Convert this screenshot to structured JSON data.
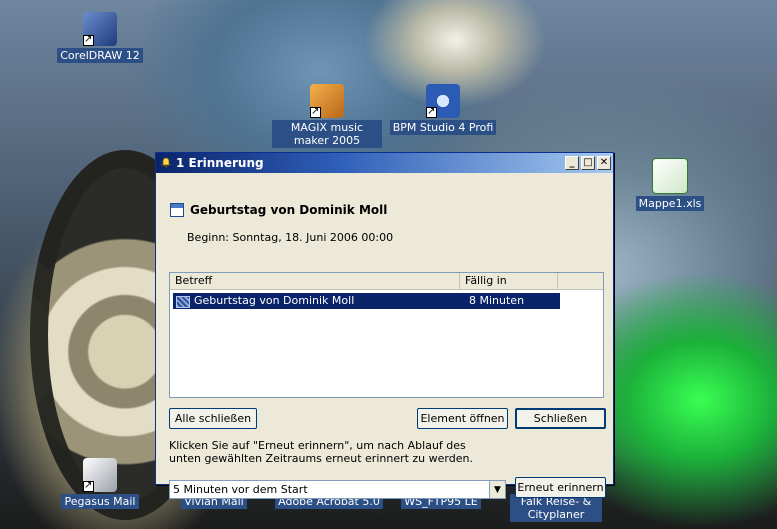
{
  "desktop": {
    "icons": [
      {
        "name": "coreldraw-icon",
        "label": "CorelDRAW 12"
      },
      {
        "name": "magix-icon",
        "label": "MAGIX music maker 2005"
      },
      {
        "name": "bpm-studio-icon",
        "label": "BPM Studio 4 Profi"
      },
      {
        "name": "excel-icon",
        "label": "Mappe1.xls"
      },
      {
        "name": "pegasus-icon",
        "label": "Pegasus Mail"
      },
      {
        "name": "vivian-icon",
        "label": "Vivian Mail"
      },
      {
        "name": "acrobat-icon",
        "label": "Adobe Acrobat 5.0"
      },
      {
        "name": "wsftp-icon",
        "label": "WS_FTP95 LE"
      },
      {
        "name": "falk-icon",
        "label": "Falk Reise- & Cityplaner"
      }
    ]
  },
  "reminder": {
    "title": "1 Erinnerung",
    "subject": "Geburtstag von Dominik Moll",
    "begin": "Beginn: Sonntag, 18. Juni 2006 00:00",
    "columns": [
      "Betreff",
      "Fällig in"
    ],
    "rows": [
      {
        "subject": "Geburtstag von Dominik Moll",
        "due": "8 Minuten"
      }
    ],
    "buttons": {
      "close_all": "Alle schließen",
      "open_item": "Element öffnen",
      "close": "Schließen",
      "snooze": "Erneut erinnern"
    },
    "note": "Klicken Sie auf \"Erneut erinnern\", um nach Ablauf des unten gewählten Zeitraums erneut erinnert zu werden.",
    "snooze_select": "5 Minuten vor dem Start",
    "window_buttons": {
      "minimize": "_",
      "maximize": "□",
      "close": "✕"
    }
  }
}
